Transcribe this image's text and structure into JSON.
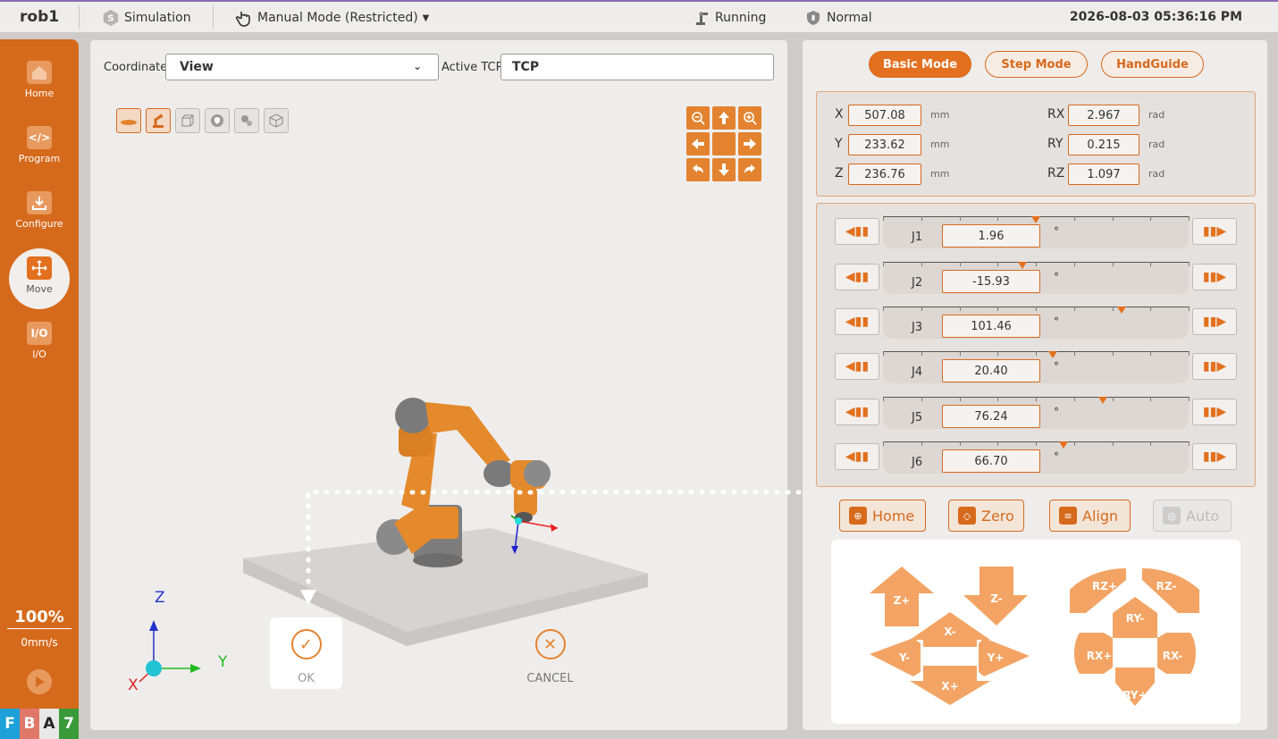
{
  "topbar": {
    "robot_name": "rob1",
    "simulation": "Simulation",
    "mode": "Manual Mode (Restricted)",
    "status": "Running",
    "safety": "Normal",
    "datetime": "2026-08-03 05:36:16 PM",
    "border_color": "#8a6bb0"
  },
  "sidebar": {
    "items": [
      {
        "label": "Home",
        "icon": "home-icon"
      },
      {
        "label": "Program",
        "icon": "code-icon"
      },
      {
        "label": "Configure",
        "icon": "download-icon"
      },
      {
        "label": "Move",
        "icon": "move-icon"
      },
      {
        "label": "I/O",
        "icon": "io-icon",
        "glyph": "I/O"
      }
    ],
    "speed_percent": "100%",
    "speed_mm": "0mm/s",
    "badges": [
      {
        "text": "F",
        "color": "#1da1d8"
      },
      {
        "text": "B",
        "color": "#e07868"
      },
      {
        "text": "A",
        "color": "#e8e8e8"
      },
      {
        "text": "7",
        "color": "#3a9a3a"
      }
    ],
    "accent_color": "#d66a1c"
  },
  "viewer": {
    "coordinate_label": "Coordinate",
    "coordinate_value": "View",
    "tcp_label": "Active TCP",
    "tcp_value": "TCP",
    "axis_labels": {
      "z": "Z",
      "y": "Y",
      "x": "X"
    },
    "ok_label": "OK",
    "cancel_label": "CANCEL"
  },
  "right": {
    "modes": [
      "Basic Mode",
      "Step Mode",
      "HandGuide"
    ],
    "active_mode": "Basic Mode",
    "cartesian": [
      {
        "label": "X",
        "value": "507.08",
        "unit": "mm"
      },
      {
        "label": "Y",
        "value": "233.62",
        "unit": "mm"
      },
      {
        "label": "Z",
        "value": "236.76",
        "unit": "mm"
      },
      {
        "label": "RX",
        "value": "2.967",
        "unit": "rad"
      },
      {
        "label": "RY",
        "value": "0.215",
        "unit": "rad"
      },
      {
        "label": "RZ",
        "value": "1.097",
        "unit": "rad"
      }
    ],
    "joints": [
      {
        "label": "J1",
        "value": "1.96",
        "unit": "°",
        "position": 0.5
      },
      {
        "label": "J2",
        "value": "-15.93",
        "unit": "°",
        "position": 0.455
      },
      {
        "label": "J3",
        "value": "101.46",
        "unit": "°",
        "position": 0.78
      },
      {
        "label": "J4",
        "value": "20.40",
        "unit": "°",
        "position": 0.557
      },
      {
        "label": "J5",
        "value": "76.24",
        "unit": "°",
        "position": 0.718
      },
      {
        "label": "J6",
        "value": "66.70",
        "unit": "°",
        "position": 0.59
      }
    ],
    "actions": [
      {
        "label": "Home",
        "icon": "home-target-icon"
      },
      {
        "label": "Zero",
        "icon": "cube-icon"
      },
      {
        "label": "Align",
        "icon": "align-icon"
      },
      {
        "label": "Auto",
        "icon": "auto-icon"
      }
    ],
    "jog_translate": {
      "zplus": "Z+",
      "zminus": "Z-",
      "xminus": "X-",
      "xplus": "X+",
      "yminus": "Y-",
      "yplus": "Y+"
    },
    "jog_rotate": {
      "rzplus": "RZ+",
      "rzminus": "RZ-",
      "ryminus": "RY-",
      "ryplus": "RY+",
      "rxplus": "RX+",
      "rxminus": "RX-"
    }
  }
}
